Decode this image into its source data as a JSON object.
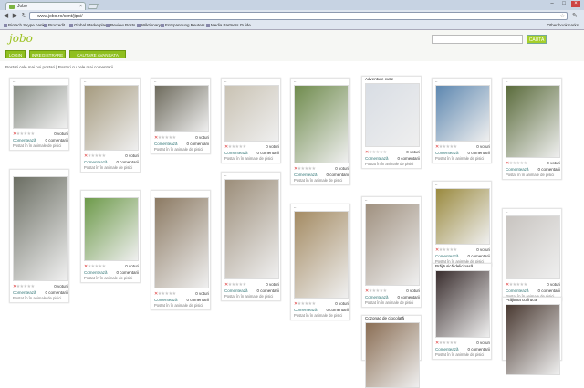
{
  "browser": {
    "tab_title": "Jobo",
    "url": "www.jobo.ro/cont/jipsi/",
    "bookmarks": [
      "Biotech.Skype bank",
      "Procredit",
      "Global Marketplace",
      "Review Posts",
      "Wiktionary",
      "Entspannung Reuters",
      "Media Partners Guide"
    ],
    "other_bookmarks": "Other bookmarks"
  },
  "site": {
    "logo": "jobo",
    "search_button": "CAUTA",
    "nav": [
      "LOGIN",
      "INREGISTRARE",
      "CAUTARE AVANSATA"
    ],
    "breadcrumb": "Postari cele mai noi postari  |  Postari cu cele mai comentarii"
  },
  "labels": {
    "dots": "..",
    "comments_link": "Comentează",
    "posted": "Postat în în animale de pisici"
  },
  "cards": [
    {
      "title": "..",
      "votes": "0 voturi",
      "comments": "0 comentarii"
    },
    {
      "title": "..",
      "votes": "0 voturi",
      "comments": "0 comentarii"
    },
    {
      "title": "..",
      "votes": "0 voturi",
      "comments": "0 comentarii"
    },
    {
      "title": "..",
      "votes": "0 voturi",
      "comments": "0 comentarii"
    },
    {
      "title": "..",
      "votes": "0 voturi",
      "comments": "0 comentarii"
    },
    {
      "title": "Adventure cutie",
      "votes": "0 voturi",
      "comments": "0 comentarii"
    },
    {
      "title": "..",
      "votes": "0 voturi",
      "comments": "0 comentarii"
    },
    {
      "title": "..",
      "votes": "0 voturi",
      "comments": "0 comentarii"
    },
    {
      "title": "..",
      "votes": "0 voturi",
      "comments": "0 comentarii"
    },
    {
      "title": "..",
      "votes": "0 voturi",
      "comments": "0 comentarii"
    },
    {
      "title": "..",
      "votes": "0 voturi",
      "comments": "0 comentarii"
    },
    {
      "title": "..",
      "votes": "0 voturi",
      "comments": "0 comentarii"
    },
    {
      "title": "..",
      "votes": "0 voturi",
      "comments": "0 comentarii"
    },
    {
      "title": "..",
      "votes": "0 voturi",
      "comments": "0 comentarii"
    },
    {
      "title": "..",
      "votes": "0 voturi",
      "comments": "0 comentarii"
    },
    {
      "title": "..",
      "votes": "0 voturi",
      "comments": "0 comentarii"
    },
    {
      "title": "Prăjiturică delicioasă",
      "votes": "0 voturi",
      "comments": "0 comentarii"
    },
    {
      "title": "Cozonac de ciocolată",
      "votes": "0 voturi",
      "comments": "0 comentarii"
    },
    {
      "title": "Prăjitura cu fructe",
      "votes": "0 voturi",
      "comments": "0 comentarii"
    }
  ],
  "colors": {
    "accent": "#9cc21f",
    "nav": "#8fbf1f"
  }
}
